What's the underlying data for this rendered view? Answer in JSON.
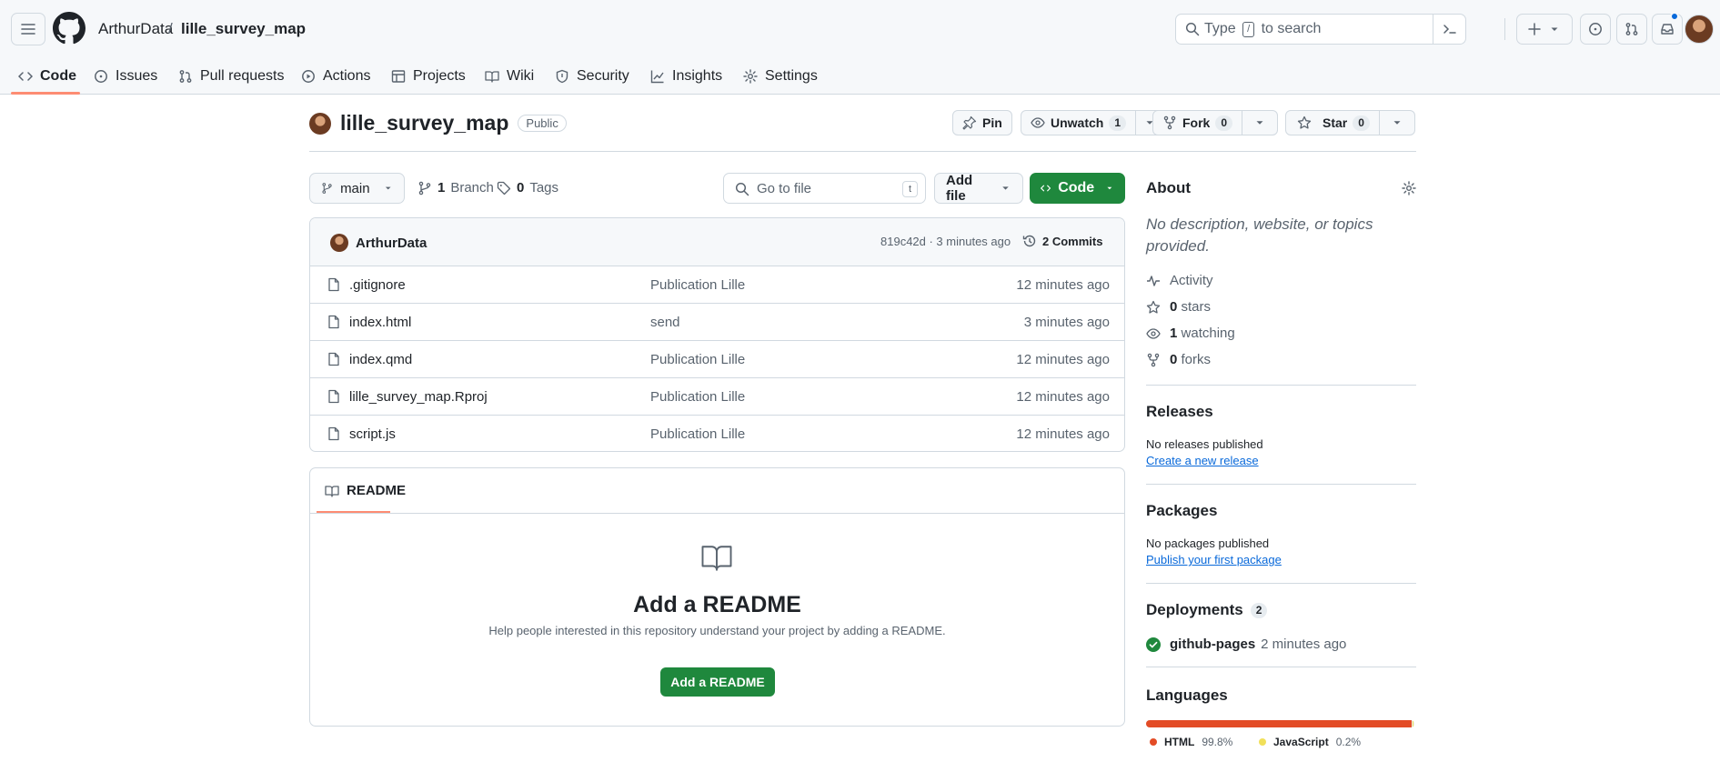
{
  "header": {
    "owner": "ArthurData",
    "separator": "/",
    "repo": "lille_survey_map",
    "search_prefix": "Type",
    "search_key": "/",
    "search_suffix": "to search"
  },
  "nav": {
    "items": [
      {
        "label": "Code",
        "icon": "code-icon"
      },
      {
        "label": "Issues",
        "icon": "issue-icon"
      },
      {
        "label": "Pull requests",
        "icon": "pull-request-icon"
      },
      {
        "label": "Actions",
        "icon": "play-icon"
      },
      {
        "label": "Projects",
        "icon": "table-icon"
      },
      {
        "label": "Wiki",
        "icon": "book-icon"
      },
      {
        "label": "Security",
        "icon": "shield-icon"
      },
      {
        "label": "Insights",
        "icon": "graph-icon"
      },
      {
        "label": "Settings",
        "icon": "gear-icon"
      }
    ]
  },
  "repo": {
    "name": "lille_survey_map",
    "visibility": "Public",
    "pin": "Pin",
    "unwatch": "Unwatch",
    "watch_count": "1",
    "fork": "Fork",
    "fork_count": "0",
    "star": "Star",
    "star_count": "0"
  },
  "branch": {
    "name": "main",
    "branch_count": "1",
    "branch_label": "Branch",
    "tag_count": "0",
    "tag_label": "Tags",
    "go_to_file": "Go to file",
    "go_to_file_key": "t",
    "add_file": "Add file",
    "code": "Code"
  },
  "commit": {
    "author": "ArthurData",
    "hash_time": "819c42d · 3 minutes ago",
    "commits": "2 Commits"
  },
  "files": [
    {
      "name": ".gitignore",
      "message": "Publication Lille",
      "date": "12 minutes ago"
    },
    {
      "name": "index.html",
      "message": "send",
      "date": "3 minutes ago"
    },
    {
      "name": "index.qmd",
      "message": "Publication Lille",
      "date": "12 minutes ago"
    },
    {
      "name": "lille_survey_map.Rproj",
      "message": "Publication Lille",
      "date": "12 minutes ago"
    },
    {
      "name": "script.js",
      "message": "Publication Lille",
      "date": "12 minutes ago"
    }
  ],
  "readme": {
    "tab": "README",
    "title": "Add a README",
    "description": "Help people interested in this repository understand your project by adding a README.",
    "button": "Add a README"
  },
  "about": {
    "heading": "About",
    "description": "No description, website, or topics provided.",
    "activity": "Activity",
    "stars_count": "0",
    "stars_label": "stars",
    "watching_count": "1",
    "watching_label": "watching",
    "forks_count": "0",
    "forks_label": "forks"
  },
  "releases": {
    "heading": "Releases",
    "text": "No releases published",
    "link": "Create a new release"
  },
  "packages": {
    "heading": "Packages",
    "text": "No packages published",
    "link": "Publish your first package"
  },
  "deployments": {
    "heading": "Deployments",
    "count": "2",
    "env": "github-pages",
    "time": "2 minutes ago"
  },
  "languages": {
    "heading": "Languages",
    "items": [
      {
        "name": "HTML",
        "percent": "99.8%",
        "share": 0.998,
        "color": "#e34c26"
      },
      {
        "name": "JavaScript",
        "percent": "0.2%",
        "share": 0.002,
        "color": "#f1e05a"
      }
    ]
  },
  "colors": {
    "accent_underline": "#fd8c73",
    "primary_green": "#1f883d",
    "link_blue": "#0969da"
  }
}
